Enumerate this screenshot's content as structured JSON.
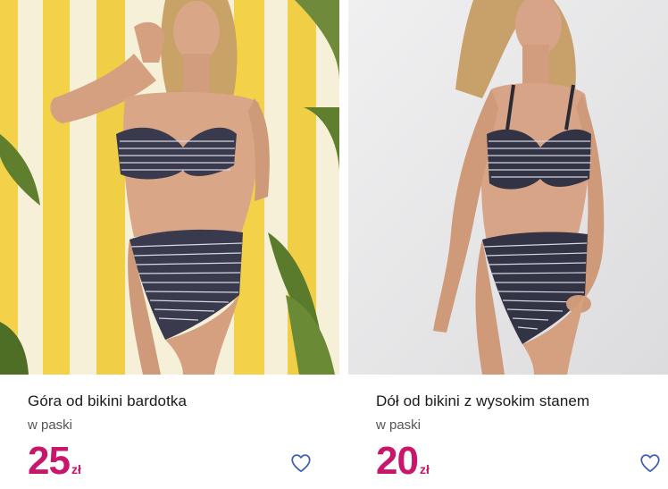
{
  "products": [
    {
      "title": "Góra od bikini bardotka",
      "variant": "w paski",
      "price_amount": "25",
      "price_currency": "zł",
      "image_alt": "Model in striped bandeau bikini against yellow and white striped wall"
    },
    {
      "title": "Dół od bikini z wysokim stanem",
      "variant": "w paski",
      "price_amount": "20",
      "price_currency": "zł",
      "image_alt": "Model in striped high-waisted bikini against grey background"
    }
  ],
  "colors": {
    "price": "#c8166a",
    "heart": "#3a5db8",
    "title": "#1a1a1a",
    "subtitle": "#555555"
  },
  "icons": {
    "wishlist": "heart-outline-icon"
  }
}
